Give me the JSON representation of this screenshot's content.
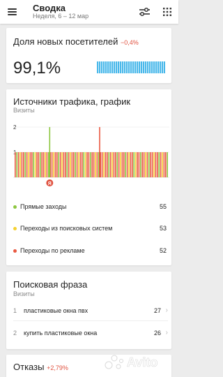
{
  "header": {
    "title": "Сводка",
    "subtitle": "Неделя, 6 – 12 мар",
    "icons": [
      "menu-icon",
      "filter-icon",
      "apps-grid-icon"
    ]
  },
  "new_visitors": {
    "title": "Доля новых посетителей",
    "delta": "−0,4%",
    "value": "99,1%",
    "bar_color": "#49b8ea"
  },
  "traffic": {
    "title": "Источники трафика, график",
    "subtitle": "Визиты",
    "marker_label": "Я",
    "legend": [
      {
        "label": "Прямые заходы",
        "value": "55",
        "color": "#8cc63f"
      },
      {
        "label": "Переходы из поисковых систем",
        "value": "53",
        "color": "#f5d130"
      },
      {
        "label": "Переходы по рекламе",
        "value": "52",
        "color": "#e9573f"
      }
    ]
  },
  "chart_data": {
    "type": "bar",
    "ytick_labels": [
      "2",
      "1"
    ],
    "ylim": [
      0,
      2
    ],
    "series_colors": [
      "#8cc63f",
      "#f5d130",
      "#e9573f"
    ],
    "peaks": [
      {
        "position": 0.23,
        "value": 2,
        "color": "#8cc63f"
      },
      {
        "position": 0.55,
        "value": 2,
        "color": "#e9573f"
      }
    ]
  },
  "phrases": {
    "title": "Поисковая фраза",
    "subtitle": "Визиты",
    "items": [
      {
        "index": "1",
        "text": "пластиковые окна пвх",
        "value": "27"
      },
      {
        "index": "2",
        "text": "купить пластиковые окна",
        "value": "26"
      }
    ]
  },
  "bounces": {
    "title": "Отказы",
    "delta": "+2,79%"
  },
  "watermark": {
    "text": "Avito"
  }
}
